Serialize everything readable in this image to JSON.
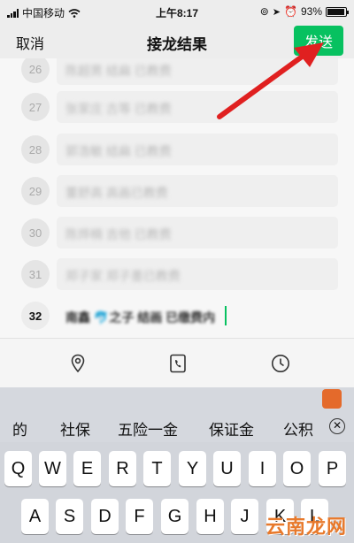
{
  "status": {
    "carrier": "中国移动",
    "time": "上午8:17",
    "battery": "93%",
    "battery_level": 0.93
  },
  "nav": {
    "cancel": "取消",
    "title": "接龙结果",
    "send": "发送"
  },
  "list": {
    "rows": [
      {
        "num": "26",
        "text": "陈超男 结扁 已教费"
      },
      {
        "num": "27",
        "text": "张家庄 古等 已教费"
      },
      {
        "num": "28",
        "text": "郭浩敏 结扁 已教费"
      },
      {
        "num": "29",
        "text": "董舒高 高画已教费"
      },
      {
        "num": "30",
        "text": "陈烨楠 吉他 已教费"
      },
      {
        "num": "31",
        "text": "郑子家 郑子墨已教费"
      },
      {
        "num": "32",
        "text": "南鑫 🐬之子 结画 已缴费内"
      }
    ]
  },
  "toolbar": {
    "icons": [
      "location-pin-icon",
      "phone-icon",
      "clock-icon"
    ]
  },
  "suggestions": [
    "的",
    "社保",
    "五险一金",
    "保证金",
    "公积"
  ],
  "keyboard": {
    "row1": [
      "Q",
      "W",
      "E",
      "R",
      "T",
      "Y",
      "U",
      "I",
      "O",
      "P"
    ],
    "row2": [
      "A",
      "S",
      "D",
      "F",
      "G",
      "H",
      "J",
      "K",
      "L"
    ]
  },
  "watermark": "云南龙网",
  "colors": {
    "accent": "#07c160",
    "arrow": "#e02020"
  }
}
